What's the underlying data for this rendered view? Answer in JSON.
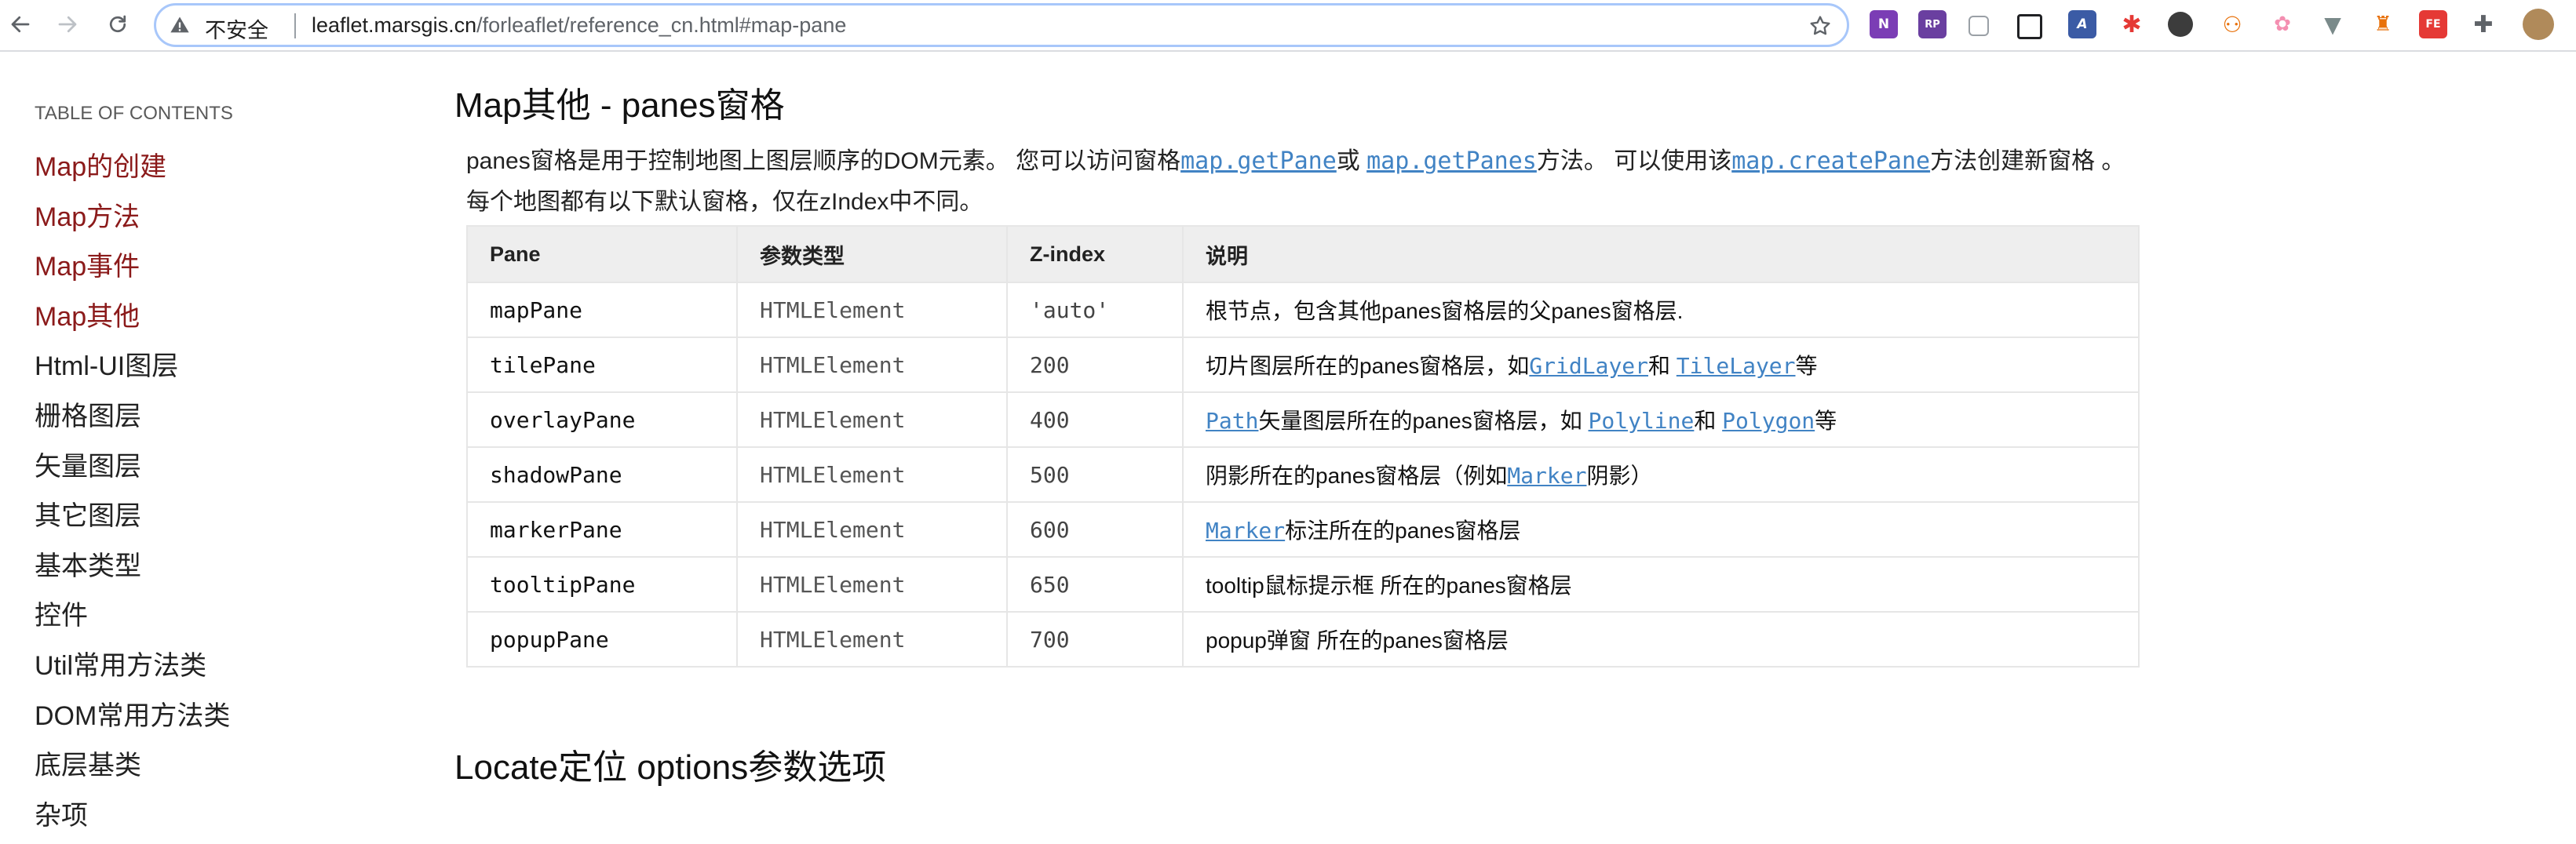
{
  "browser": {
    "security_label": "不安全",
    "url_host": "leaflet.marsgis.cn",
    "url_path": "/forleaflet/reference_cn.html#map-pane",
    "extension_icons": [
      "onenote-icon",
      "rp-icon",
      "reader-icon",
      "qr-scan-icon",
      "font-icon",
      "pinwheel-icon",
      "dark-mode-icon",
      "network-icon",
      "cute-icon",
      "vue-devtools-icon",
      "lock-ext-icon",
      "fe-helper-icon",
      "puzzle-icon",
      "profile-avatar"
    ]
  },
  "toc": {
    "title": "TABLE OF CONTENTS",
    "items": [
      {
        "label": "Map的创建",
        "style": "link"
      },
      {
        "label": "Map方法",
        "style": "link"
      },
      {
        "label": "Map事件",
        "style": "link"
      },
      {
        "label": "Map其他",
        "style": "link"
      },
      {
        "label": "Html-UI图层",
        "style": "plain"
      },
      {
        "label": "栅格图层",
        "style": "plain"
      },
      {
        "label": "矢量图层",
        "style": "plain"
      },
      {
        "label": "其它图层",
        "style": "plain"
      },
      {
        "label": "基本类型",
        "style": "plain"
      },
      {
        "label": "控件",
        "style": "plain"
      },
      {
        "label": "Util常用方法类",
        "style": "plain"
      },
      {
        "label": "DOM常用方法类",
        "style": "plain"
      },
      {
        "label": "底层基类",
        "style": "plain"
      },
      {
        "label": "杂项",
        "style": "plain"
      }
    ]
  },
  "section": {
    "title": "Map其他 - panes窗格",
    "intro": {
      "t1": "panes窗格是用于控制地图上图层顺序的DOM元素。 您可以访问窗格",
      "l1": "map.getPane",
      "t2": "或 ",
      "l2": "map.getPanes",
      "t3": "方法。 可以使用该",
      "l3": "map.createPane",
      "t4": "方法创建新窗格 。 每个地图都有以下默认窗格，仅在zIndex中不同。"
    },
    "table": {
      "headers": [
        "Pane",
        "参数类型",
        "Z-index",
        "说明"
      ],
      "rows": [
        {
          "pane": "mapPane",
          "type": "HTMLElement",
          "z": "'auto'",
          "desc": [
            {
              "t": "根节点，包含其他panes窗格层的父panes窗格层."
            }
          ]
        },
        {
          "pane": "tilePane",
          "type": "HTMLElement",
          "z": "200",
          "desc": [
            {
              "t": "切片图层所在的panes窗格层，如"
            },
            {
              "l": "GridLayer"
            },
            {
              "t": "和 "
            },
            {
              "l": "TileLayer"
            },
            {
              "t": "等"
            }
          ]
        },
        {
          "pane": "overlayPane",
          "type": "HTMLElement",
          "z": "400",
          "desc": [
            {
              "l": "Path"
            },
            {
              "t": "矢量图层所在的panes窗格层，如 "
            },
            {
              "l": "Polyline"
            },
            {
              "t": "和 "
            },
            {
              "l": "Polygon"
            },
            {
              "t": "等"
            }
          ]
        },
        {
          "pane": "shadowPane",
          "type": "HTMLElement",
          "z": "500",
          "desc": [
            {
              "t": "阴影所在的panes窗格层（例如"
            },
            {
              "l": "Marker"
            },
            {
              "t": "阴影）"
            }
          ]
        },
        {
          "pane": "markerPane",
          "type": "HTMLElement",
          "z": "600",
          "desc": [
            {
              "l": "Marker"
            },
            {
              "t": "标注所在的panes窗格层"
            }
          ]
        },
        {
          "pane": "tooltipPane",
          "type": "HTMLElement",
          "z": "650",
          "desc": [
            {
              "t": "tooltip鼠标提示框 所在的panes窗格层"
            }
          ]
        },
        {
          "pane": "popupPane",
          "type": "HTMLElement",
          "z": "700",
          "desc": [
            {
              "t": "popup弹窗 所在的panes窗格层"
            }
          ]
        }
      ]
    }
  },
  "next_section": {
    "title": "Locate定位 options参数选项"
  }
}
